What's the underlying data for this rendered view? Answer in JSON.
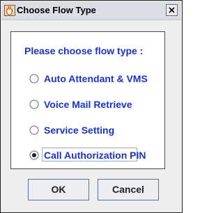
{
  "window": {
    "title": "Choose Flow Type",
    "close_icon": "close-icon",
    "app_icon": "java-cup-icon"
  },
  "prompt": "Please choose flow type :",
  "options": [
    {
      "label": "Auto Attendant & VMS",
      "selected": false
    },
    {
      "label": "Voice Mail Retrieve",
      "selected": false
    },
    {
      "label": "Service Setting",
      "selected": false
    },
    {
      "label": "Call Authorization PIN",
      "selected": true
    }
  ],
  "buttons": {
    "ok": "OK",
    "cancel": "Cancel"
  },
  "colors": {
    "text_accent": "#1a33cc",
    "background": "#eeeeee",
    "panel": "#ffffff"
  }
}
